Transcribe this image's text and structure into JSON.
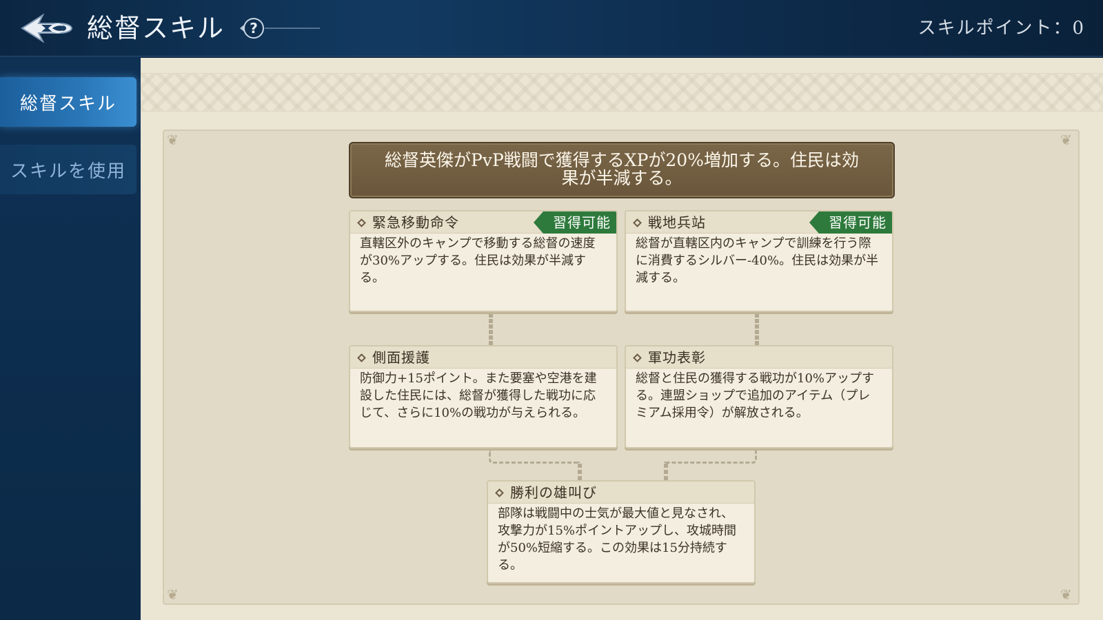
{
  "header": {
    "title": "総督スキル",
    "skill_points_label": "スキルポイント：",
    "skill_points_value": "0"
  },
  "sidebar": {
    "items": [
      {
        "label": "総督スキル",
        "active": true
      },
      {
        "label": "スキルを使用",
        "active": false
      }
    ]
  },
  "banner": {
    "text_line1": "総督英傑がPvP戦闘で獲得するXPが20%増加する。住民は効",
    "text_line2": "果が半減する。"
  },
  "skills": [
    {
      "name": "緊急移動命令",
      "badge": "習得可能",
      "description": "直轄区外のキャンプで移動する総督の速度が30%アップする。住民は効果が半減する。"
    },
    {
      "name": "戦地兵站",
      "badge": "習得可能",
      "description": "総督が直轄区内のキャンプで訓練を行う際に消費するシルバー-40%。住民は効果が半減する。"
    },
    {
      "name": "側面援護",
      "badge": "",
      "description": "防御力+15ポイント。また要塞や空港を建設した住民には、総督が獲得した戦功に応じて、さらに10%の戦功が与えられる。"
    },
    {
      "name": "軍功表彰",
      "badge": "",
      "description": "総督と住民の獲得する戦功が10%アップする。連盟ショップで追加のアイテム（プレミアム採用令）が解放される。"
    },
    {
      "name": "勝利の雄叫び",
      "badge": "",
      "description": "部隊は戦闘中の士気が最大値と見なされ、攻撃力が15%ポイントアップし、攻城時間が50%短縮する。この効果は15分持続する。"
    }
  ],
  "colors": {
    "header_bg": "#0b2642",
    "sidebar_active": "#2a77b8",
    "panel_bg": "#ebe5d4",
    "banner_bg": "#6a563a",
    "badge_green": "#2e7a3c"
  },
  "icons": {
    "back": "back-arrow-icon",
    "help": "question-icon",
    "node": "diamond-icon"
  }
}
